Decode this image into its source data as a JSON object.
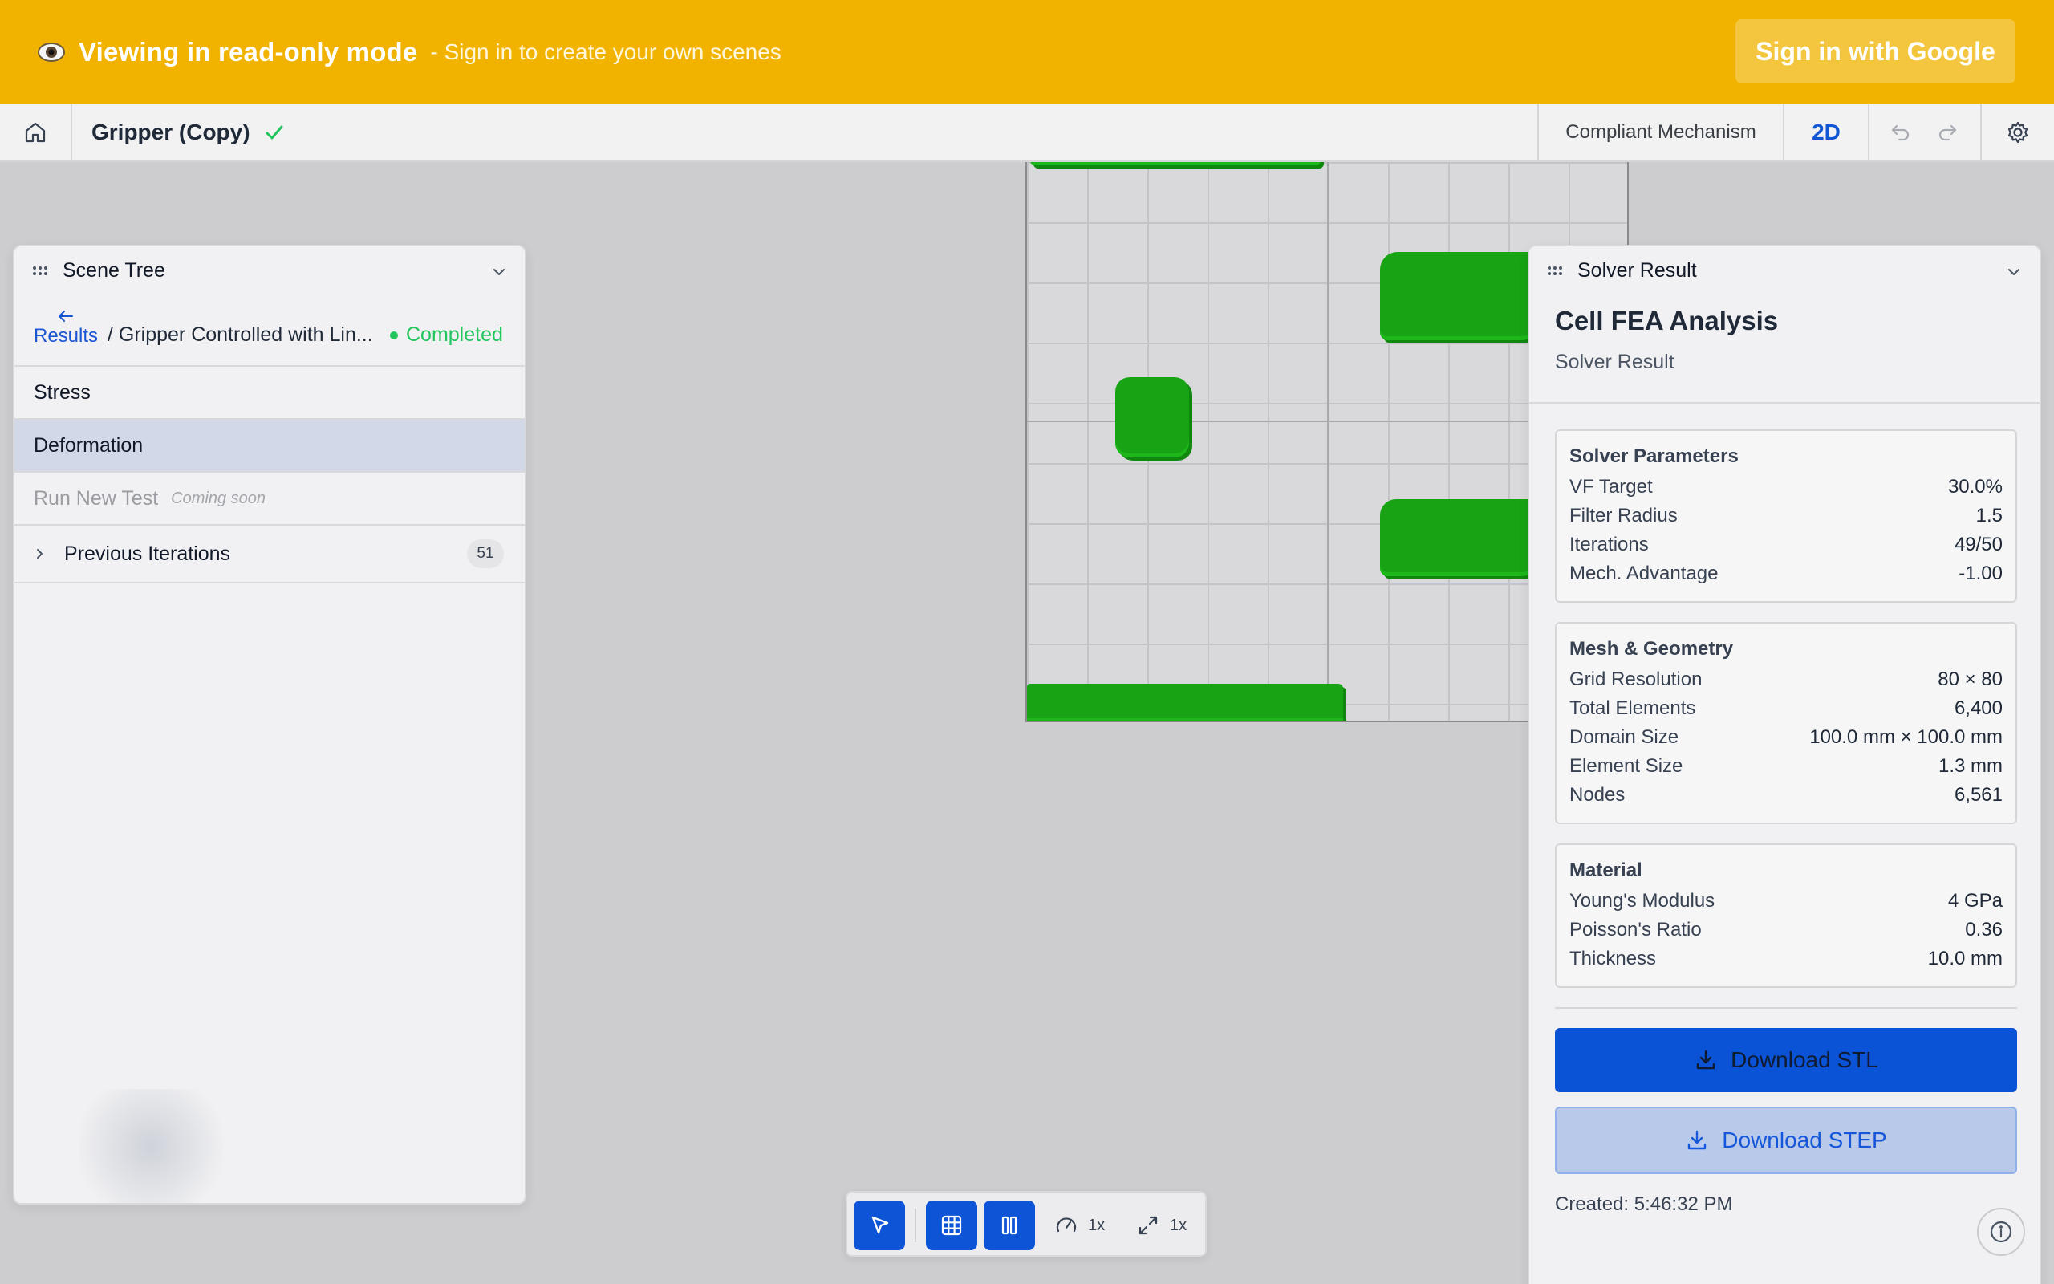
{
  "banner": {
    "icon": "eye-icon",
    "title": "Viewing in read-only mode",
    "subtitle": "- Sign in to create your own scenes",
    "signin_label": "Sign in with Google",
    "color": "#f1b300"
  },
  "toolbar": {
    "scene_name": "Gripper (Copy)",
    "mode_label": "Compliant Mechanism",
    "view_label": "2D",
    "icons": [
      "home-icon",
      "check-icon",
      "undo-icon",
      "redo-icon",
      "gear-icon"
    ],
    "accent": "#1157d4"
  },
  "scene_tree": {
    "title": "Scene Tree",
    "back_label": "Results",
    "breadcrumb": "/ Gripper Controlled with Lin...",
    "status": "Completed",
    "status_color": "#22c55e",
    "items": [
      {
        "label": "Stress"
      },
      {
        "label": "Deformation"
      },
      {
        "label": "Run New Test",
        "note": "Coming soon"
      }
    ],
    "iterations_label": "Previous Iterations",
    "iterations_count": "51"
  },
  "solver": {
    "panel_title": "Solver Result",
    "title": "Cell FEA Analysis",
    "subtitle": "Solver Result",
    "sections": [
      {
        "title": "Solver Parameters",
        "rows": [
          {
            "label": "VF Target",
            "value": "30.0%"
          },
          {
            "label": "Filter Radius",
            "value": "1.5"
          },
          {
            "label": "Iterations",
            "value": "49/50"
          },
          {
            "label": "Mech. Advantage",
            "value": "-1.00"
          }
        ]
      },
      {
        "title": "Mesh & Geometry",
        "rows": [
          {
            "label": "Grid Resolution",
            "value": "80 × 80"
          },
          {
            "label": "Total Elements",
            "value": "6,400"
          },
          {
            "label": "Domain Size",
            "value": "100.0 mm × 100.0 mm"
          },
          {
            "label": "Element Size",
            "value": "1.3 mm"
          },
          {
            "label": "Nodes",
            "value": "6,561"
          }
        ]
      },
      {
        "title": "Material",
        "rows": [
          {
            "label": "Young's Modulus",
            "value": "4 GPa"
          },
          {
            "label": "Poisson's Ratio",
            "value": "0.36"
          },
          {
            "label": "Thickness",
            "value": "10.0 mm"
          }
        ]
      }
    ],
    "download_stl": "Download STL",
    "download_step": "Download STEP",
    "created": "Created: 5:46:32 PM",
    "primary_color": "#0a53d6"
  },
  "bottom_toolbar": {
    "speed_label": "1x",
    "scale_label": "1x",
    "icons": [
      "select-pointer-icon",
      "grid-icon",
      "pause-icon",
      "speed-gauge-icon",
      "expand-icon"
    ]
  },
  "canvas": {
    "material_color": "#17a314"
  }
}
